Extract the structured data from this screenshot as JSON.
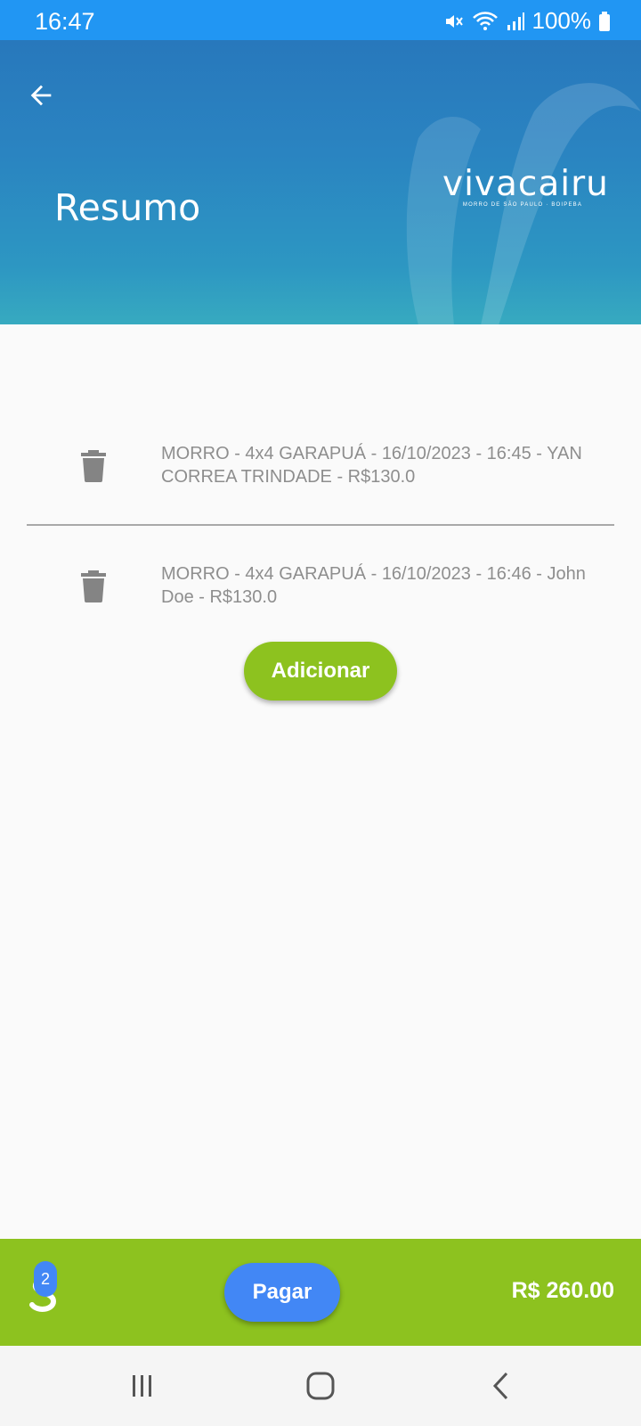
{
  "status_bar": {
    "time": "16:47",
    "battery": "100%",
    "icons": [
      "mute-icon",
      "wifi-icon",
      "signal-icon",
      "battery-icon"
    ]
  },
  "header": {
    "title": "Resumo",
    "back_icon": "arrow-left-icon",
    "logo_word": "vivacairu",
    "logo_sub": "MORRO DE SÃO PAULO · BOIPEBA"
  },
  "cart": {
    "items": [
      {
        "text": "MORRO - 4x4 GARAPUÁ - 16/10/2023 - 16:45 - YAN CORREA TRINDADE - R$130.0",
        "icon": "trash-icon"
      },
      {
        "text": "MORRO - 4x4 GARAPUÁ - 16/10/2023 - 16:46 - John Doe - R$130.0",
        "icon": "trash-icon"
      }
    ],
    "add_label": "Adicionar"
  },
  "footer": {
    "badge_count": "2",
    "pay_label": "Pagar",
    "total": "R$ 260.00"
  },
  "colors": {
    "status_bar": "#2196f3",
    "accent_green": "#8dc21f",
    "accent_blue": "#4287f5",
    "item_text": "#8e8e8e"
  }
}
